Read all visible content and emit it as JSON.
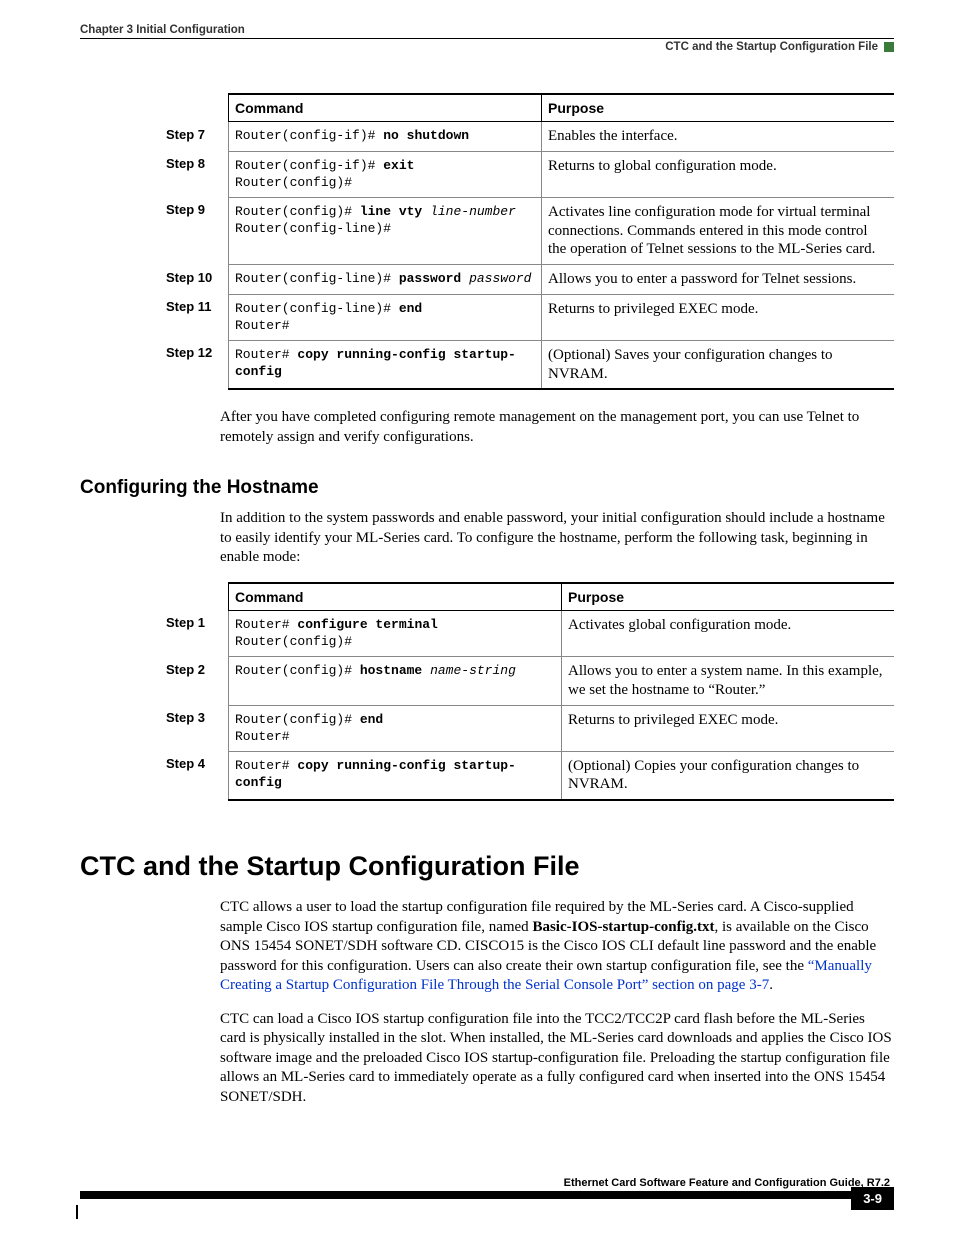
{
  "header": {
    "chapter": "Chapter 3    Initial Configuration",
    "section_right": "CTC and the Startup Configuration File"
  },
  "table1": {
    "h_command": "Command",
    "h_purpose": "Purpose",
    "rows": [
      {
        "step": "Step 7",
        "cmd_html": "Router(config-if)# <span class='b'>no shutdown</span>",
        "purpose": "Enables the interface."
      },
      {
        "step": "Step 8",
        "cmd_html": "Router(config-if)# <span class='b'>exit</span><br>Router(config)#",
        "purpose": "Returns to global configuration mode."
      },
      {
        "step": "Step 9",
        "cmd_html": "Router(config)# <span class='b'>line vty</span> <span class='i'>line-number</span><br>Router(config-line)#",
        "purpose": "Activates line configuration mode for virtual terminal connections. Commands entered in this mode control the operation of Telnet sessions to the ML-Series card."
      },
      {
        "step": "Step 10",
        "cmd_html": "Router(config-line)# <span class='b'>password</span> <span class='i'>password</span>",
        "purpose": "Allows you to enter a password for Telnet sessions."
      },
      {
        "step": "Step 11",
        "cmd_html": "Router(config-line)# <span class='b'>end</span><br>Router#",
        "purpose": "Returns to privileged EXEC mode."
      },
      {
        "step": "Step 12",
        "cmd_html": "Router# <span class='b'>copy running-config startup-config</span>",
        "purpose": "(Optional) Saves your configuration changes to NVRAM."
      }
    ]
  },
  "para1": "After you have completed configuring remote management on the management port, you can use Telnet to remotely assign and verify configurations.",
  "sub_heading": "Configuring the Hostname",
  "para2": "In addition to the system passwords and enable password, your initial configuration should include a hostname to easily identify your ML-Series card. To configure the hostname, perform the following task, beginning in enable mode:",
  "table2": {
    "h_command": "Command",
    "h_purpose": "Purpose",
    "rows": [
      {
        "step": "Step 1",
        "cmd_html": "Router# <span class='b'>configure terminal</span><br>Router(config)#",
        "purpose": "Activates global configuration mode."
      },
      {
        "step": "Step 2",
        "cmd_html": "Router(config)# <span class='b'>hostname</span> <span class='i'>name-string</span>",
        "purpose": "Allows you to enter a system name. In this example, we set the hostname to “Router.”"
      },
      {
        "step": "Step 3",
        "cmd_html": "Router(config)# <span class='b'>end</span><br>Router#",
        "purpose": "Returns to privileged EXEC mode."
      },
      {
        "step": "Step 4",
        "cmd_html": "Router# <span class='b'>copy running-config startup-config</span>",
        "purpose": "(Optional) Copies your configuration changes to NVRAM."
      }
    ]
  },
  "main_heading": "CTC and the Startup Configuration File",
  "para3_pre": "CTC allows a user to load the startup configuration file required by the ML-Series card. A Cisco-supplied sample Cisco IOS startup configuration file, named ",
  "para3_bold": "Basic-IOS-startup-config.txt",
  "para3_post": ", is available on the Cisco ONS 15454 SONET/SDH software CD. CISCO15 is the Cisco IOS CLI default line password and the enable password for this configuration. Users can also create their own startup configuration file, see the ",
  "para3_link": "“Manually Creating a Startup Configuration File Through the Serial Console Port” section on page 3-7",
  "para3_end": ".",
  "para4": "CTC can load a Cisco IOS startup configuration file into the TCC2/TCC2P card flash before the ML-Series card is physically installed in the slot. When installed, the ML-Series card downloads and applies the Cisco IOS software image and the preloaded Cisco IOS startup-configuration file. Preloading the startup configuration file allows an ML-Series card to immediately operate as a fully configured card when inserted into the ONS 15454 SONET/SDH.",
  "footer": {
    "title": "Ethernet Card Software Feature and Configuration Guide, R7.2",
    "page": "3-9"
  }
}
